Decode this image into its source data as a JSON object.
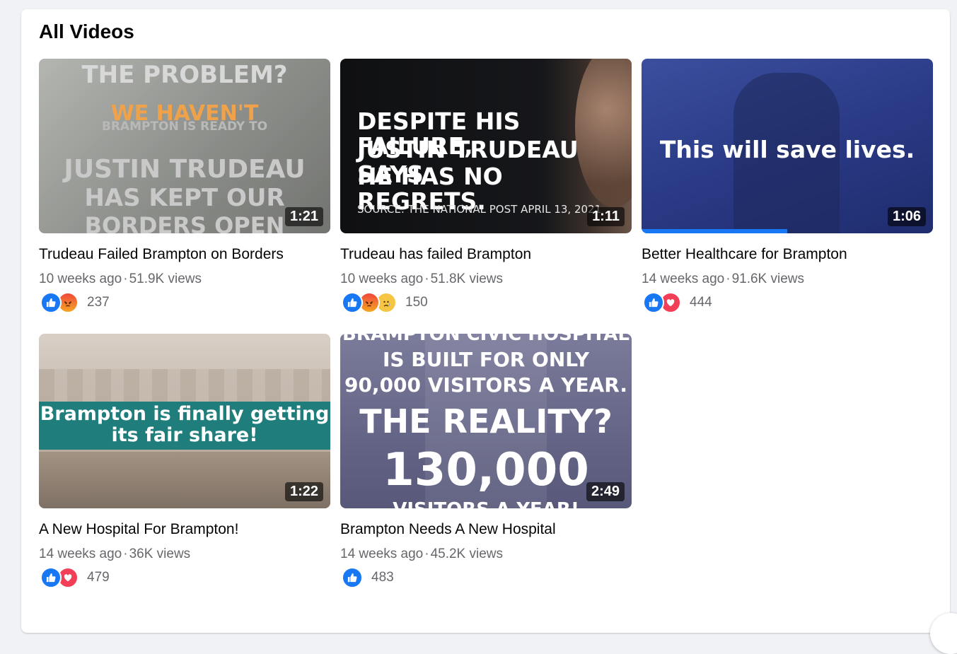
{
  "section": {
    "heading": "All Videos"
  },
  "videos": [
    {
      "title": "Trudeau Failed Brampton on Borders",
      "age": "10 weeks ago",
      "views": "51.9K views",
      "duration": "1:21",
      "reaction_count": "237",
      "reactions": [
        "like-icon",
        "angry-icon"
      ],
      "thumb_lines": [
        "THE PROBLEM?",
        "WE HAVEN'T",
        "BRAMPTON IS READY TO",
        "JUSTIN TRUDEAU",
        "HAS KEPT OUR",
        "BORDERS OPEN"
      ],
      "thumb_bg": "#8d8f8c"
    },
    {
      "title": "Trudeau has failed Brampton",
      "age": "10 weeks ago",
      "views": "51.8K views",
      "duration": "1:11",
      "reaction_count": "150",
      "reactions": [
        "like-icon",
        "angry-icon",
        "sad-icon"
      ],
      "thumb_lines": [
        "DESPITE HIS FAILURE,",
        "JUSTIN TRUDEAU SAYS",
        "HE HAS NO REGRETS."
      ],
      "thumb_source": "SOURCE: THE NATIONAL POST APRIL 13, 2021",
      "thumb_bg": "#121214"
    },
    {
      "title": "Better Healthcare for Brampton",
      "age": "14 weeks ago",
      "views": "91.6K views",
      "duration": "1:06",
      "reaction_count": "444",
      "reactions": [
        "like-icon",
        "love-icon"
      ],
      "thumb_lines": [
        "This will save lives."
      ],
      "thumb_bg": "#2c3f8f"
    },
    {
      "title": "A New Hospital For Brampton!",
      "age": "14 weeks ago",
      "views": "36K views",
      "duration": "1:22",
      "reaction_count": "479",
      "reactions": [
        "like-icon",
        "love-icon"
      ],
      "thumb_lines": [
        "Brampton is finally getting",
        "its fair share!"
      ],
      "thumb_bg": "#c9bfb4"
    },
    {
      "title": "Brampton Needs A New Hospital",
      "age": "14 weeks ago",
      "views": "45.2K views",
      "duration": "2:49",
      "reaction_count": "483",
      "reactions": [
        "like-icon"
      ],
      "thumb_lines": [
        "BRAMPTON CIVIC HOSPITAL",
        "IS BUILT FOR ONLY",
        "90,000 VISITORS A YEAR.",
        "THE REALITY?",
        "130,000",
        "VISITORS A YEAR!"
      ],
      "thumb_bg": "#6e6e90"
    }
  ],
  "colors": {
    "like": "#1877f2",
    "love": "#f33e58",
    "angry": "#e9710f",
    "sad": "#f7b125",
    "teal_banner": "#1f7d7b"
  }
}
